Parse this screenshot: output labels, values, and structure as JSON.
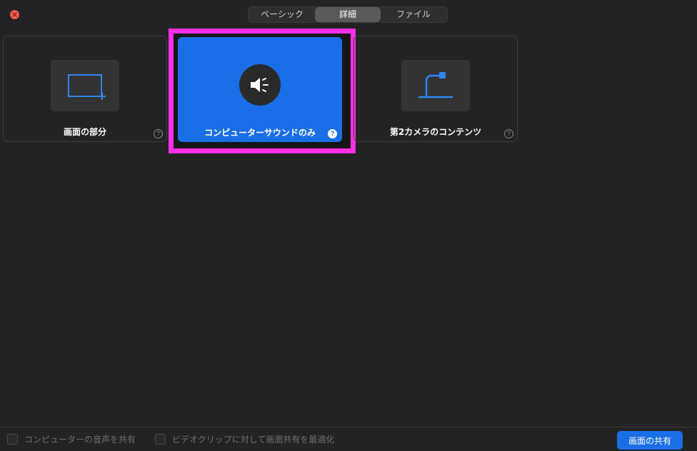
{
  "tabs": [
    {
      "label": "ベーシック",
      "active": false
    },
    {
      "label": "詳細",
      "active": true
    },
    {
      "label": "ファイル",
      "active": false
    }
  ],
  "options": {
    "portion": {
      "label": "画面の部分",
      "icon": "screen-portion-icon"
    },
    "computer_sound": {
      "label": "コンピューターサウンドのみ",
      "icon": "speaker-icon",
      "selected": true
    },
    "second_camera": {
      "label": "第2カメラのコンテンツ",
      "icon": "document-camera-icon"
    }
  },
  "help_glyph": "?",
  "footer": {
    "share_audio_label": "コンピューターの音声を共有",
    "optimize_video_label": "ビデオクリップに対して画面共有を最適化",
    "share_button_label": "画面の共有"
  },
  "colors": {
    "accent": "#1a6fe8",
    "highlight": "#ff2fe5",
    "close": "#ff5f57",
    "background": "#232323"
  }
}
